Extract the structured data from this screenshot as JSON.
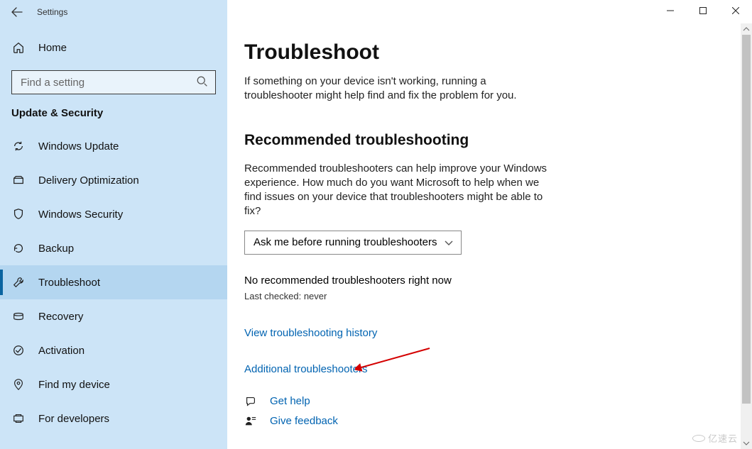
{
  "app_title": "Settings",
  "sidebar": {
    "home": "Home",
    "search_placeholder": "Find a setting",
    "section": "Update & Security",
    "items": [
      {
        "label": "Windows Update"
      },
      {
        "label": "Delivery Optimization"
      },
      {
        "label": "Windows Security"
      },
      {
        "label": "Backup"
      },
      {
        "label": "Troubleshoot"
      },
      {
        "label": "Recovery"
      },
      {
        "label": "Activation"
      },
      {
        "label": "Find my device"
      },
      {
        "label": "For developers"
      }
    ]
  },
  "main": {
    "title": "Troubleshoot",
    "intro": "If something on your device isn't working, running a troubleshooter might help find and fix the problem for you.",
    "rec_heading": "Recommended troubleshooting",
    "rec_desc": "Recommended troubleshooters can help improve your Windows experience. How much do you want Microsoft to help when we find issues on your device that troubleshooters might be able to fix?",
    "dropdown_value": "Ask me before running troubleshooters",
    "no_rec": "No recommended troubleshooters right now",
    "last_checked": "Last checked: never",
    "link_history": "View troubleshooting history",
    "link_additional": "Additional troubleshooters",
    "get_help": "Get help",
    "give_feedback": "Give feedback"
  },
  "watermark": "亿速云"
}
